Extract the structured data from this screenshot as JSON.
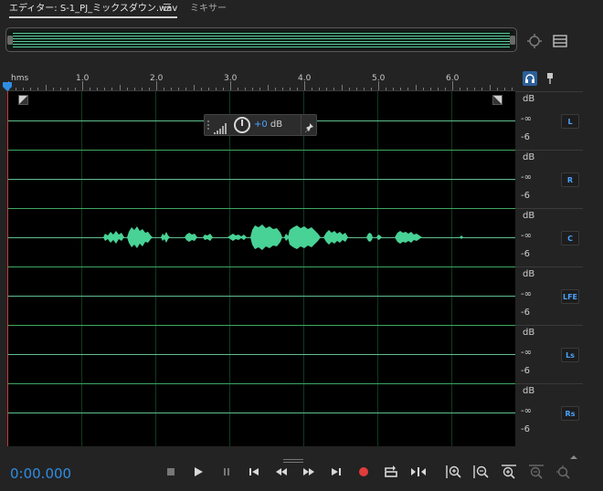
{
  "tabs": {
    "editor_label": "エディター: S-1_PJ_ミックスダウン.wav",
    "menu_glyph": "☰",
    "mixer_label": "ミキサー"
  },
  "ruler": {
    "labels": [
      "hms",
      "1.0",
      "2.0",
      "3.0",
      "4.0",
      "5.0",
      "6.0"
    ]
  },
  "hud": {
    "value": "+0",
    "unit": " dB"
  },
  "channels": [
    {
      "name": "L",
      "db": "dB",
      "inf": "-∞",
      "m6": "-6"
    },
    {
      "name": "R",
      "db": "dB",
      "inf": "-∞",
      "m6": "-6"
    },
    {
      "name": "C",
      "db": "dB",
      "inf": "-∞",
      "m6": "-6"
    },
    {
      "name": "LFE",
      "db": "dB",
      "inf": "-∞",
      "m6": "-6"
    },
    {
      "name": "Ls",
      "db": "dB",
      "inf": "-∞",
      "m6": "-6"
    },
    {
      "name": "Rs",
      "db": "dB",
      "inf": "-∞",
      "m6": "-6"
    }
  ],
  "transport": {
    "time": "0:00.000"
  },
  "colors": {
    "accent": "#2f8de4",
    "waveform": "#48d295",
    "record": "#e23c3c"
  }
}
